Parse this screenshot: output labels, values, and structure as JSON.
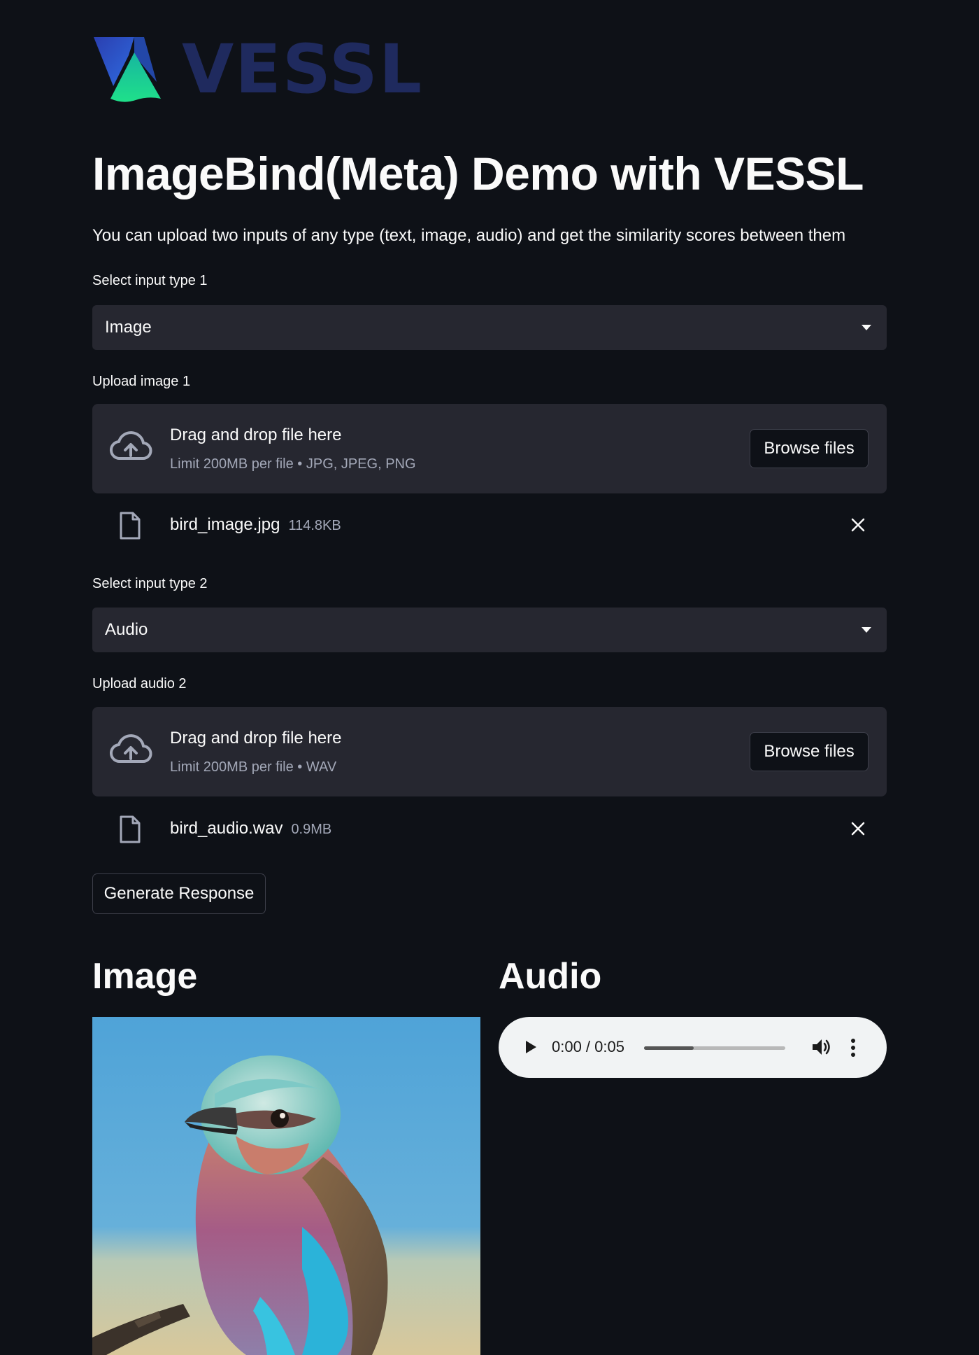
{
  "logo": {
    "wordmark": "VESSL",
    "colors": {
      "blue": "#2b4dbd",
      "green": "#1fd38a",
      "text": "#1f2a5e"
    }
  },
  "page": {
    "title": "ImageBind(Meta) Demo with VESSL",
    "subtitle": "You can upload two inputs of any type (text, image, audio) and get the similarity scores between them"
  },
  "input1": {
    "select_label": "Select input type 1",
    "select_value": "Image",
    "upload_label": "Upload image 1",
    "dropzone_title": "Drag and drop file here",
    "dropzone_limit": "Limit 200MB per file • JPG, JPEG, PNG",
    "browse_label": "Browse files",
    "file_name": "bird_image.jpg",
    "file_size": "114.8KB"
  },
  "input2": {
    "select_label": "Select input type 2",
    "select_value": "Audio",
    "upload_label": "Upload audio 2",
    "dropzone_title": "Drag and drop file here",
    "dropzone_limit": "Limit 200MB per file • WAV",
    "browse_label": "Browse files",
    "file_name": "bird_audio.wav",
    "file_size": "0.9MB"
  },
  "generate_label": "Generate Response",
  "results": {
    "image_heading": "Image",
    "audio_heading": "Audio",
    "audio_player": {
      "time": "0:00 / 0:05",
      "progress_fraction": 0.35
    }
  },
  "colors": {
    "background": "#0e1117",
    "widget": "#262730",
    "text": "#fafafa",
    "muted": "#a3a8b8"
  }
}
